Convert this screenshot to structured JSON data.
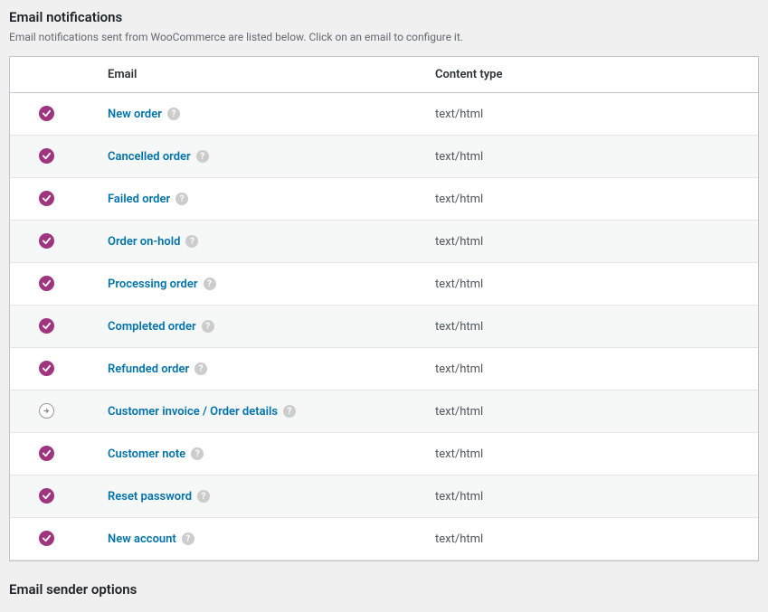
{
  "header": {
    "title": "Email notifications",
    "description": "Email notifications sent from WooCommerce are listed below. Click on an email to configure it."
  },
  "table": {
    "columns": {
      "email": "Email",
      "content_type": "Content type"
    },
    "rows": [
      {
        "status": "enabled",
        "name": "New order",
        "content_type": "text/html"
      },
      {
        "status": "enabled",
        "name": "Cancelled order",
        "content_type": "text/html"
      },
      {
        "status": "enabled",
        "name": "Failed order",
        "content_type": "text/html"
      },
      {
        "status": "enabled",
        "name": "Order on-hold",
        "content_type": "text/html"
      },
      {
        "status": "enabled",
        "name": "Processing order",
        "content_type": "text/html"
      },
      {
        "status": "enabled",
        "name": "Completed order",
        "content_type": "text/html"
      },
      {
        "status": "enabled",
        "name": "Refunded order",
        "content_type": "text/html"
      },
      {
        "status": "manual",
        "name": "Customer invoice / Order details",
        "content_type": "text/html"
      },
      {
        "status": "enabled",
        "name": "Customer note",
        "content_type": "text/html"
      },
      {
        "status": "enabled",
        "name": "Reset password",
        "content_type": "text/html"
      },
      {
        "status": "enabled",
        "name": "New account",
        "content_type": "text/html"
      }
    ]
  },
  "next_section": {
    "title": "Email sender options"
  },
  "help_glyph": "?"
}
